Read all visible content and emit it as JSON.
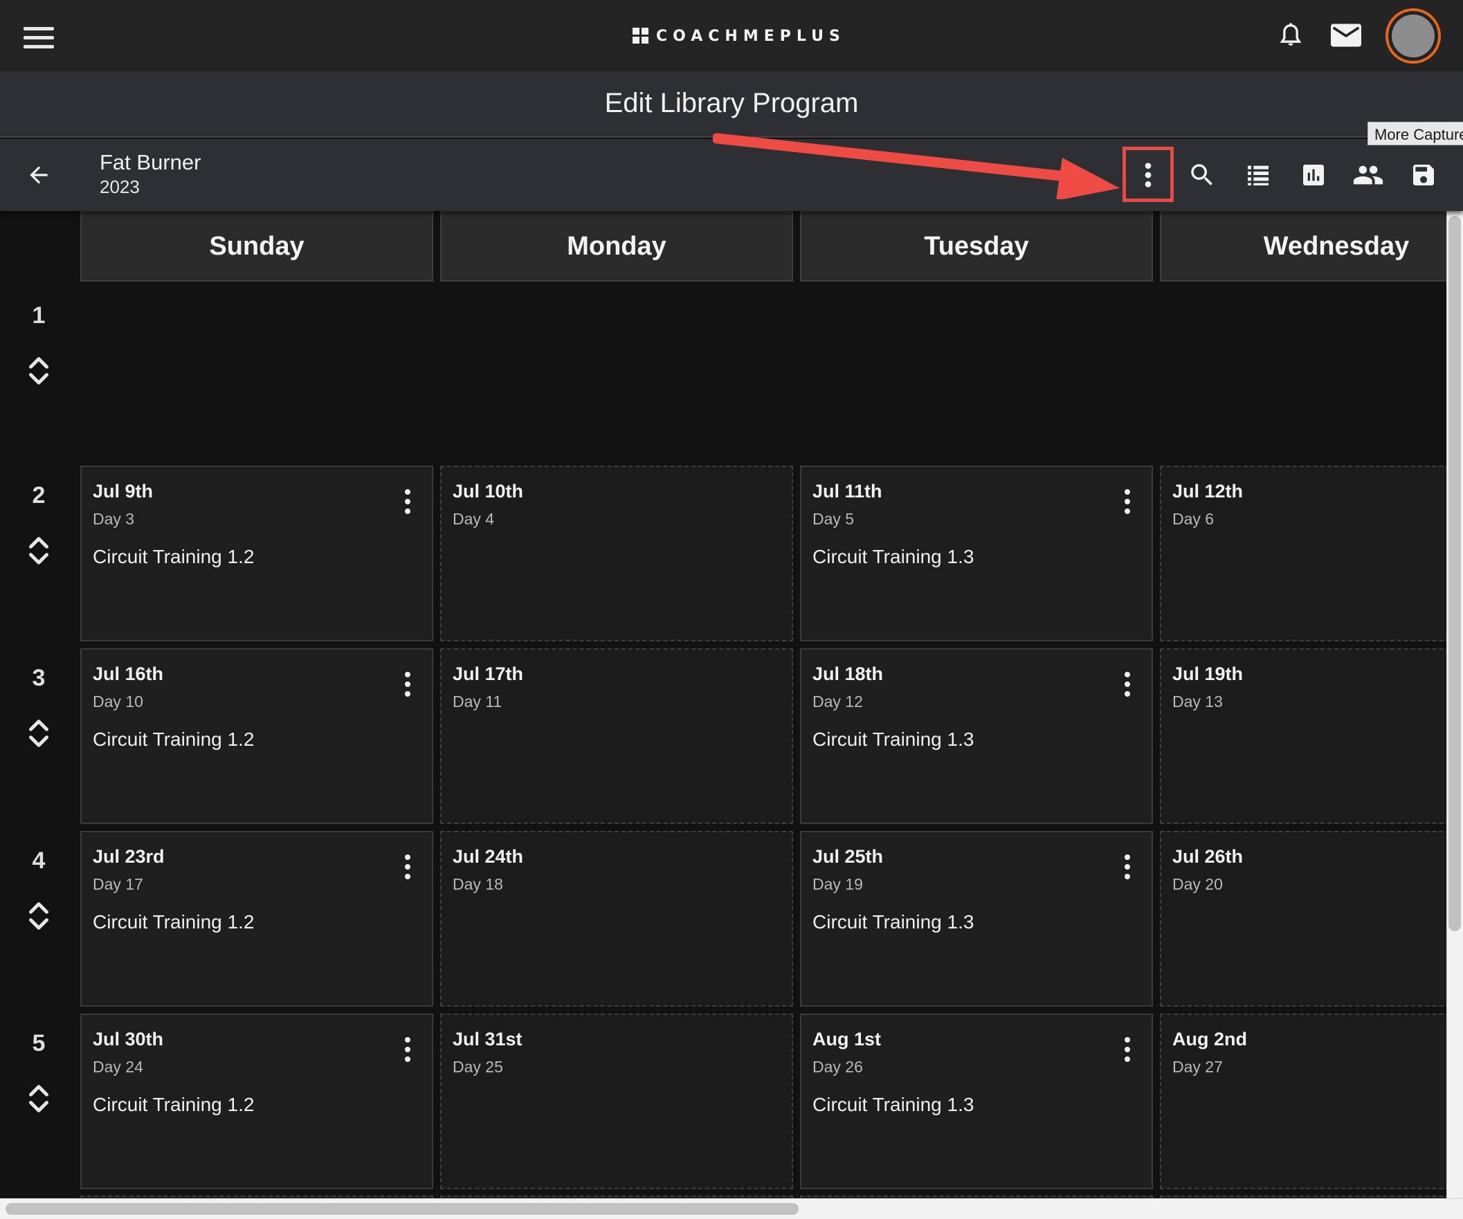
{
  "app": {
    "logo_text": "COACHMEPLUS"
  },
  "header": {
    "icons": [
      "menu-icon",
      "bell-icon",
      "mail-icon",
      "avatar"
    ],
    "avatar_border_color": "#e8651c"
  },
  "page": {
    "title": "Edit Library Program"
  },
  "program": {
    "name": "Fat Burner",
    "year": "2023"
  },
  "toolbar": {
    "icons": [
      "back-arrow-icon",
      "more-vert-icon",
      "search-icon",
      "list-icon",
      "bar-chart-icon",
      "people-icon",
      "save-icon"
    ],
    "tooltip": "More Capture",
    "highlight_color": "#e84a4a"
  },
  "calendar": {
    "day_headers": [
      "Sunday",
      "Monday",
      "Tuesday",
      "Wednesday"
    ],
    "weeks": [
      {
        "number": "1",
        "days": []
      },
      {
        "number": "2",
        "days": [
          {
            "date": "Jul 9th",
            "day": "Day 3",
            "workout": "Circuit Training 1.2"
          },
          {
            "date": "Jul 10th",
            "day": "Day 4",
            "workout": ""
          },
          {
            "date": "Jul 11th",
            "day": "Day 5",
            "workout": "Circuit Training 1.3"
          },
          {
            "date": "Jul 12th",
            "day": "Day 6",
            "workout": ""
          }
        ]
      },
      {
        "number": "3",
        "days": [
          {
            "date": "Jul 16th",
            "day": "Day 10",
            "workout": "Circuit Training 1.2"
          },
          {
            "date": "Jul 17th",
            "day": "Day 11",
            "workout": ""
          },
          {
            "date": "Jul 18th",
            "day": "Day 12",
            "workout": "Circuit Training 1.3"
          },
          {
            "date": "Jul 19th",
            "day": "Day 13",
            "workout": ""
          }
        ]
      },
      {
        "number": "4",
        "days": [
          {
            "date": "Jul 23rd",
            "day": "Day 17",
            "workout": "Circuit Training 1.2"
          },
          {
            "date": "Jul 24th",
            "day": "Day 18",
            "workout": ""
          },
          {
            "date": "Jul 25th",
            "day": "Day 19",
            "workout": "Circuit Training 1.3"
          },
          {
            "date": "Jul 26th",
            "day": "Day 20",
            "workout": ""
          }
        ]
      },
      {
        "number": "5",
        "days": [
          {
            "date": "Jul 30th",
            "day": "Day 24",
            "workout": "Circuit Training 1.2"
          },
          {
            "date": "Jul 31st",
            "day": "Day 25",
            "workout": ""
          },
          {
            "date": "Aug 1st",
            "day": "Day 26",
            "workout": "Circuit Training 1.3"
          },
          {
            "date": "Aug 2nd",
            "day": "Day 27",
            "workout": ""
          }
        ]
      }
    ]
  }
}
